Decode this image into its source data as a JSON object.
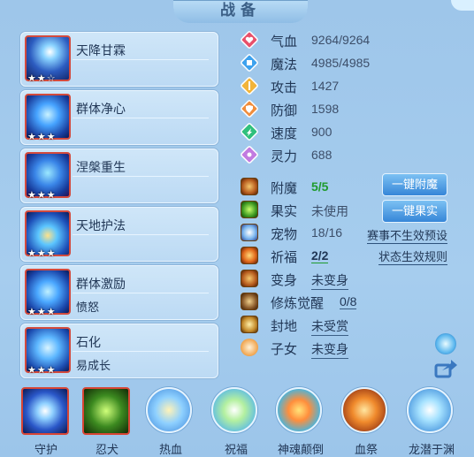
{
  "title": "战备",
  "skills": [
    {
      "name": "天降甘霖",
      "sub": "",
      "stars": "★★☆"
    },
    {
      "name": "群体净心",
      "sub": "",
      "stars": "★★★"
    },
    {
      "name": "涅槃重生",
      "sub": "",
      "stars": "★★★"
    },
    {
      "name": "天地护法",
      "sub": "",
      "stars": "★★★"
    },
    {
      "name": "群体激励",
      "sub": "愤怒",
      "stars": "★★★"
    },
    {
      "name": "石化",
      "sub": "易成长",
      "stars": "★★★"
    }
  ],
  "stats": [
    {
      "label": "气血",
      "value": "9264/9264",
      "icon": "heart-icon",
      "color": "#e8506b"
    },
    {
      "label": "魔法",
      "value": "4985/4985",
      "icon": "mana-icon",
      "color": "#3ea2ee"
    },
    {
      "label": "攻击",
      "value": "1427",
      "icon": "attack-icon",
      "color": "#f2b43a"
    },
    {
      "label": "防御",
      "value": "1598",
      "icon": "defense-icon",
      "color": "#f08d3d"
    },
    {
      "label": "速度",
      "value": "900",
      "icon": "speed-icon",
      "color": "#2fc07c"
    },
    {
      "label": "灵力",
      "value": "688",
      "icon": "spirit-icon",
      "color": "#c27be0"
    }
  ],
  "equip": [
    {
      "label": "附魔",
      "value": "5/5",
      "style": "green"
    },
    {
      "label": "果实",
      "value": "未使用",
      "style": ""
    },
    {
      "label": "宠物",
      "value": "18/16",
      "style": ""
    },
    {
      "label": "祈福",
      "value": "2/2",
      "style": "green"
    },
    {
      "label": "变身",
      "value": "未变身",
      "style": "u"
    },
    {
      "label": "修炼觉醒",
      "value": "0/8",
      "style": "u"
    },
    {
      "label": "封地",
      "value": "未受赏",
      "style": "u"
    },
    {
      "label": "子女",
      "value": "未变身",
      "style": "u"
    }
  ],
  "buttons": {
    "enchant": "一键附魔",
    "fruit": "一键果实"
  },
  "links": {
    "match_preset": "赛事不生效预设",
    "state_rules": "状态生效规则"
  },
  "bottom_items": [
    {
      "label": "守护",
      "icon": "guard-icon"
    },
    {
      "label": "忍犬",
      "icon": "ninja-dog-icon"
    },
    {
      "label": "热血",
      "icon": "hot-blood-icon"
    },
    {
      "label": "祝福",
      "icon": "blessing-icon"
    },
    {
      "label": "神魂颠倒",
      "icon": "soul-icon"
    },
    {
      "label": "血祭",
      "icon": "blood-sacrifice-icon"
    },
    {
      "label": "龙潜于渊",
      "icon": "dragon-icon"
    }
  ]
}
